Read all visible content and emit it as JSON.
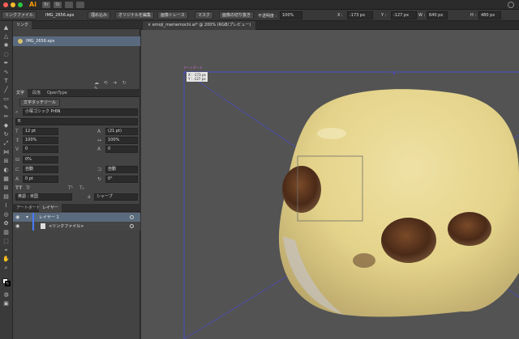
{
  "app": {
    "logo": "Ai"
  },
  "titlebar": {
    "icons": [
      "Br",
      "St"
    ]
  },
  "controlbar": {
    "link_file_button": "リンクファイル",
    "filename": "IMG_2656.eps",
    "embed_button": "埋め込み",
    "edit_original_button": "オリジナルを編集",
    "image_trace_button": "画像トレース",
    "mask_button": "マスク",
    "crop_image_button": "画像の切り抜き",
    "opacity_label": "不透明度 :",
    "opacity_value": "100%",
    "x_label": "X :",
    "x_value": "-173 px",
    "y_label": "Y :",
    "y_value": "-127 px",
    "w_label": "W :",
    "w_value": "640 px",
    "h_label": "H :",
    "h_value": "480 px"
  },
  "links_panel": {
    "tab_label": "リンク",
    "items": [
      {
        "name": "IMG_2656.eps"
      }
    ]
  },
  "character_panel": {
    "tabs": [
      "文字",
      "段落",
      "OpenType"
    ],
    "touch_tool_button": "文字タッチツール",
    "font_family": "小塚ゴシック Pr6N",
    "font_style": "R",
    "font_size": "12 pt",
    "leading": "(21 pt)",
    "vertical_scale": "100%",
    "horizontal_scale": "100%",
    "kerning": "0",
    "tracking": "0",
    "tsume": "0%",
    "aki_left": "自動",
    "aki_right": "自動",
    "baseline_shift": "0 pt",
    "rotation": "0°",
    "style_buttons": [
      "TT",
      "Tr",
      "T¹",
      "T₁"
    ],
    "language": "英語 : 米国",
    "antialias": "シャープ"
  },
  "layers_panel": {
    "tabs": [
      "アートボード",
      "レイヤー"
    ],
    "layers": [
      {
        "name": "レイヤー 1"
      },
      {
        "name": "<リンクファイル>"
      }
    ]
  },
  "document": {
    "tab_title": "emoji_mamemochi.ai* @ 200% (RGB/プレビュー)"
  },
  "canvas": {
    "coord_x": "X : -173 px",
    "coord_y": "Y : -127 px",
    "artboard_label": "アートボード"
  },
  "colors": {
    "accent": "#4a7bff",
    "selection": "#596a7e",
    "mochi": "#e8d9a0",
    "bean": "#4a2a18"
  }
}
